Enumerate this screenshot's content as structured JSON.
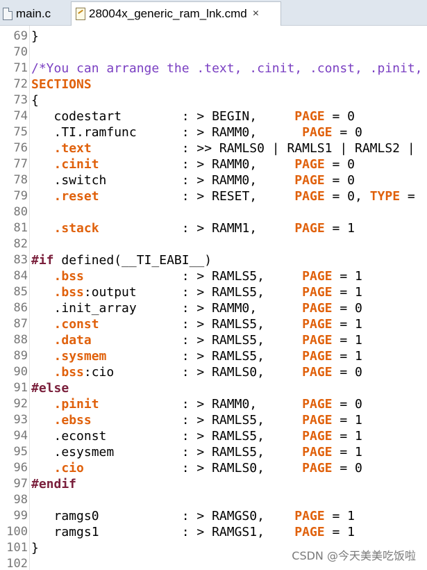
{
  "tabs": [
    {
      "label": "main.c",
      "icon": "c-file-icon",
      "active": false
    },
    {
      "label": "28004x_generic_ram_lnk.cmd",
      "icon": "cmd-file-icon",
      "active": true,
      "close": "×"
    }
  ],
  "lines": [
    {
      "n": "69",
      "code": [
        {
          "t": "}",
          "c": ""
        }
      ]
    },
    {
      "n": "70",
      "code": []
    },
    {
      "n": "71",
      "code": [
        {
          "t": "/*You can arrange the .text, .cinit, .const, .pinit,",
          "c": "cm"
        }
      ]
    },
    {
      "n": "72",
      "code": [
        {
          "t": "SECTIONS",
          "c": "kw"
        }
      ]
    },
    {
      "n": "73",
      "code": [
        {
          "t": "{",
          "c": ""
        }
      ]
    },
    {
      "n": "74",
      "code": [
        {
          "t": "   codestart        : > BEGIN,     ",
          "c": ""
        },
        {
          "t": "PAGE",
          "c": "kw"
        },
        {
          "t": " = 0",
          "c": ""
        }
      ]
    },
    {
      "n": "75",
      "code": [
        {
          "t": "   .TI.ramfunc      : > RAMM0,      ",
          "c": ""
        },
        {
          "t": "PAGE",
          "c": "kw"
        },
        {
          "t": " = 0",
          "c": ""
        }
      ]
    },
    {
      "n": "76",
      "code": [
        {
          "t": "   ",
          "c": ""
        },
        {
          "t": ".text",
          "c": "kw"
        },
        {
          "t": "            : >> RAMLS0 | RAMLS1 | RAMLS2 |",
          "c": ""
        }
      ]
    },
    {
      "n": "77",
      "code": [
        {
          "t": "   ",
          "c": ""
        },
        {
          "t": ".cinit",
          "c": "kw"
        },
        {
          "t": "           : > RAMM0,     ",
          "c": ""
        },
        {
          "t": "PAGE",
          "c": "kw"
        },
        {
          "t": " = 0",
          "c": ""
        }
      ]
    },
    {
      "n": "78",
      "code": [
        {
          "t": "   .switch          : > RAMM0,     ",
          "c": ""
        },
        {
          "t": "PAGE",
          "c": "kw"
        },
        {
          "t": " = 0",
          "c": ""
        }
      ]
    },
    {
      "n": "79",
      "code": [
        {
          "t": "   ",
          "c": ""
        },
        {
          "t": ".reset",
          "c": "kw"
        },
        {
          "t": "           : > RESET,     ",
          "c": ""
        },
        {
          "t": "PAGE",
          "c": "kw"
        },
        {
          "t": " = 0, ",
          "c": ""
        },
        {
          "t": "TYPE",
          "c": "kw"
        },
        {
          "t": " =",
          "c": ""
        }
      ]
    },
    {
      "n": "80",
      "code": []
    },
    {
      "n": "81",
      "code": [
        {
          "t": "   ",
          "c": ""
        },
        {
          "t": ".stack",
          "c": "kw"
        },
        {
          "t": "           : > RAMM1,     ",
          "c": ""
        },
        {
          "t": "PAGE",
          "c": "kw"
        },
        {
          "t": " = 1",
          "c": ""
        }
      ]
    },
    {
      "n": "82",
      "code": []
    },
    {
      "n": "83",
      "code": [
        {
          "t": "#if",
          "c": "pre"
        },
        {
          "t": " defined(__TI_EABI__)",
          "c": ""
        }
      ]
    },
    {
      "n": "84",
      "code": [
        {
          "t": "   ",
          "c": ""
        },
        {
          "t": ".bss",
          "c": "kw"
        },
        {
          "t": "             : > RAMLS5,     ",
          "c": ""
        },
        {
          "t": "PAGE",
          "c": "kw"
        },
        {
          "t": " = 1",
          "c": ""
        }
      ]
    },
    {
      "n": "85",
      "code": [
        {
          "t": "   ",
          "c": ""
        },
        {
          "t": ".bss",
          "c": "kw"
        },
        {
          "t": ":output      : > RAMLS5,     ",
          "c": ""
        },
        {
          "t": "PAGE",
          "c": "kw"
        },
        {
          "t": " = 1",
          "c": ""
        }
      ]
    },
    {
      "n": "86",
      "code": [
        {
          "t": "   .init_array      : > RAMM0,      ",
          "c": ""
        },
        {
          "t": "PAGE",
          "c": "kw"
        },
        {
          "t": " = 0",
          "c": ""
        }
      ]
    },
    {
      "n": "87",
      "code": [
        {
          "t": "   ",
          "c": ""
        },
        {
          "t": ".const",
          "c": "kw"
        },
        {
          "t": "           : > RAMLS5,     ",
          "c": ""
        },
        {
          "t": "PAGE",
          "c": "kw"
        },
        {
          "t": " = 1",
          "c": ""
        }
      ]
    },
    {
      "n": "88",
      "code": [
        {
          "t": "   ",
          "c": ""
        },
        {
          "t": ".data",
          "c": "kw"
        },
        {
          "t": "            : > RAMLS5,     ",
          "c": ""
        },
        {
          "t": "PAGE",
          "c": "kw"
        },
        {
          "t": " = 1",
          "c": ""
        }
      ]
    },
    {
      "n": "89",
      "code": [
        {
          "t": "   ",
          "c": ""
        },
        {
          "t": ".sysmem",
          "c": "kw"
        },
        {
          "t": "          : > RAMLS5,     ",
          "c": ""
        },
        {
          "t": "PAGE",
          "c": "kw"
        },
        {
          "t": " = 1",
          "c": ""
        }
      ]
    },
    {
      "n": "90",
      "code": [
        {
          "t": "   ",
          "c": ""
        },
        {
          "t": ".bss",
          "c": "kw"
        },
        {
          "t": ":cio         : > RAMLS0,     ",
          "c": ""
        },
        {
          "t": "PAGE",
          "c": "kw"
        },
        {
          "t": " = 0",
          "c": ""
        }
      ]
    },
    {
      "n": "91",
      "code": [
        {
          "t": "#else",
          "c": "pre"
        }
      ]
    },
    {
      "n": "92",
      "code": [
        {
          "t": "   ",
          "c": ""
        },
        {
          "t": ".pinit",
          "c": "kw"
        },
        {
          "t": "           : > RAMM0,      ",
          "c": ""
        },
        {
          "t": "PAGE",
          "c": "kw"
        },
        {
          "t": " = 0",
          "c": ""
        }
      ]
    },
    {
      "n": "93",
      "code": [
        {
          "t": "   ",
          "c": ""
        },
        {
          "t": ".ebss",
          "c": "kw"
        },
        {
          "t": "            : > RAMLS5,     ",
          "c": ""
        },
        {
          "t": "PAGE",
          "c": "kw"
        },
        {
          "t": " = 1",
          "c": ""
        }
      ]
    },
    {
      "n": "94",
      "code": [
        {
          "t": "   .econst          : > RAMLS5,     ",
          "c": ""
        },
        {
          "t": "PAGE",
          "c": "kw"
        },
        {
          "t": " = 1",
          "c": ""
        }
      ]
    },
    {
      "n": "95",
      "code": [
        {
          "t": "   .esysmem         : > RAMLS5,     ",
          "c": ""
        },
        {
          "t": "PAGE",
          "c": "kw"
        },
        {
          "t": " = 1",
          "c": ""
        }
      ]
    },
    {
      "n": "96",
      "code": [
        {
          "t": "   ",
          "c": ""
        },
        {
          "t": ".cio",
          "c": "kw"
        },
        {
          "t": "             : > RAMLS0,     ",
          "c": ""
        },
        {
          "t": "PAGE",
          "c": "kw"
        },
        {
          "t": " = 0",
          "c": ""
        }
      ]
    },
    {
      "n": "97",
      "code": [
        {
          "t": "#endif",
          "c": "pre"
        }
      ]
    },
    {
      "n": "98",
      "code": []
    },
    {
      "n": "99",
      "code": [
        {
          "t": "   ramgs0           : > RAMGS0,    ",
          "c": ""
        },
        {
          "t": "PAGE",
          "c": "kw"
        },
        {
          "t": " = 1",
          "c": ""
        }
      ]
    },
    {
      "n": "100",
      "code": [
        {
          "t": "   ramgs1           : > RAMGS1,    ",
          "c": ""
        },
        {
          "t": "PAGE",
          "c": "kw"
        },
        {
          "t": " = 1",
          "c": ""
        }
      ]
    },
    {
      "n": "101",
      "code": [
        {
          "t": "}",
          "c": ""
        }
      ]
    },
    {
      "n": "102",
      "code": []
    }
  ],
  "watermark": "CSDN @今天美美吃饭啦"
}
